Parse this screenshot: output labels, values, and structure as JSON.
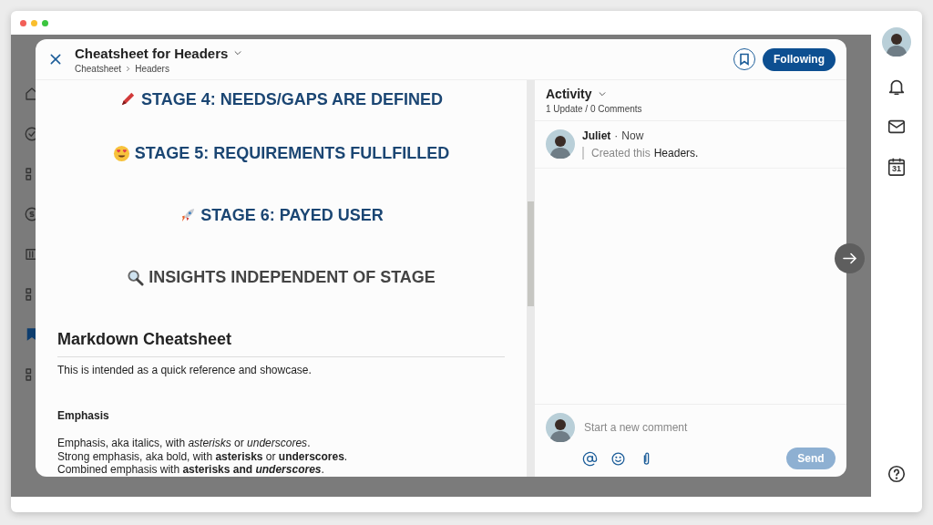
{
  "modal": {
    "title": "Cheatsheet for Headers",
    "breadcrumb": [
      "Cheatsheet",
      "Headers"
    ],
    "follow_button": "Following"
  },
  "document": {
    "stage_headings": [
      {
        "kind": "pencil",
        "text": "STAGE 4: NEEDS/GAPS ARE DEFINED",
        "color": "#1b4673"
      },
      {
        "kind": "heart-eyes",
        "text": "STAGE 5: REQUIREMENTS FULLFILLED",
        "color": "#1b4673"
      },
      {
        "kind": "rocket",
        "text": "STAGE 6: PAYED USER",
        "color": "#1b4673"
      },
      {
        "kind": "magnifier",
        "text": "INSIGHTS INDEPENDENT OF STAGE",
        "color": "#444444"
      }
    ],
    "title": "Markdown Cheatsheet",
    "intro": "This is intended as a quick reference and showcase.",
    "section": "Emphasis",
    "lines": [
      "Emphasis, aka italics, with *asterisks* or *underscores*.",
      "Strong emphasis, aka bold, with **asterisks** or **underscores**.",
      {
        "segments": [
          {
            "text": "Combined emphasis with ",
            "bold": false,
            "italic": false
          },
          {
            "text": "asterisks and ",
            "bold": true,
            "italic": false
          },
          {
            "text": "underscores",
            "bold": true,
            "italic": true
          },
          {
            "text": ".",
            "bold": false,
            "italic": false
          }
        ]
      }
    ]
  },
  "activity": {
    "title": "Activity",
    "summary": "1 Update / 0 Comments",
    "entries": [
      {
        "author": "Juliet",
        "separator": "·",
        "time": "Now",
        "action": "Created this",
        "object": "Headers."
      }
    ]
  },
  "composer": {
    "placeholder": "Start a new comment",
    "send": {
      "label": "Send",
      "disabled": true
    }
  },
  "right_rail": {
    "calendar_day": "31"
  }
}
